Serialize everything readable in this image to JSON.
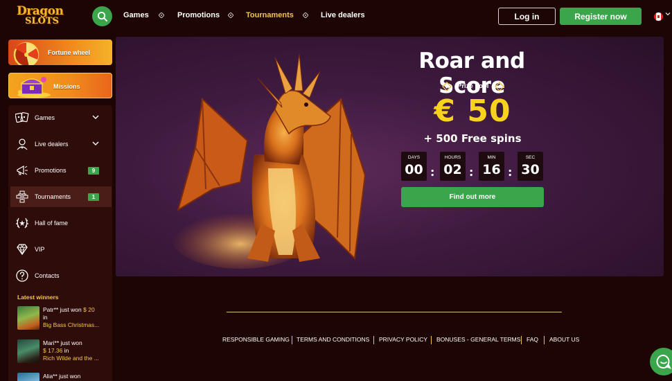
{
  "brand": {
    "logo_line1": "Dragon",
    "logo_line2": "SLOTS"
  },
  "header": {
    "nav": [
      {
        "label": "Games",
        "active": false
      },
      {
        "label": "Promotions",
        "active": false
      },
      {
        "label": "Tournaments",
        "active": true
      },
      {
        "label": "Live dealers",
        "active": false
      }
    ],
    "login_label": "Log in",
    "register_label": "Register now"
  },
  "sidebar": {
    "promo_cards": [
      {
        "label": "Fortune wheel"
      },
      {
        "label": "Missions"
      }
    ],
    "menu": [
      {
        "label": "Games",
        "icon": "games-icon",
        "has_chevron": true
      },
      {
        "label": "Live dealers",
        "icon": "live-dealer-icon",
        "has_chevron": true
      },
      {
        "label": "Promotions",
        "icon": "megaphone-icon",
        "badge": "9"
      },
      {
        "label": "Tournaments",
        "icon": "tournament-icon",
        "badge": "1",
        "active": true
      },
      {
        "label": "Hall of fame",
        "icon": "laurel-icon"
      },
      {
        "label": "VIP",
        "icon": "diamond-icon"
      },
      {
        "label": "Contacts",
        "icon": "question-icon"
      }
    ],
    "winners_title": "Latest winners",
    "winners": [
      {
        "name_text": "Patr** just won",
        "amount": "$ 20",
        "in_text": "in",
        "game": "Big Bass Christmas..."
      },
      {
        "name_text": "Mari** just won",
        "amount": "$ 17.36",
        "in_text": "in",
        "game": "Rich Wilde and the ..."
      },
      {
        "name_text": "Alia** just won"
      }
    ]
  },
  "banner": {
    "title": "Roar and Score",
    "prize_pool_label": "Prize pool",
    "prize_amount": "€ 50",
    "free_spins": "+ 500 Free spins",
    "countdown": [
      {
        "label": "DAYS",
        "value": "00"
      },
      {
        "label": "HOURS",
        "value": "02"
      },
      {
        "label": "MIN",
        "value": "16"
      },
      {
        "label": "SEC",
        "value": "30"
      }
    ],
    "cta_label": "Find out more"
  },
  "footer": {
    "links": [
      "RESPONSIBLE GAMING",
      "TERMS AND CONDITIONS",
      "PRIVACY POLICY",
      "BONUSES - GENERAL TERMS",
      "FAQ",
      "ABOUT US"
    ]
  },
  "colors": {
    "accent_green": "#3aa54a",
    "gold": "#f4c64a",
    "background": "#1d0503",
    "prize_yellow": "#f7d21e"
  }
}
